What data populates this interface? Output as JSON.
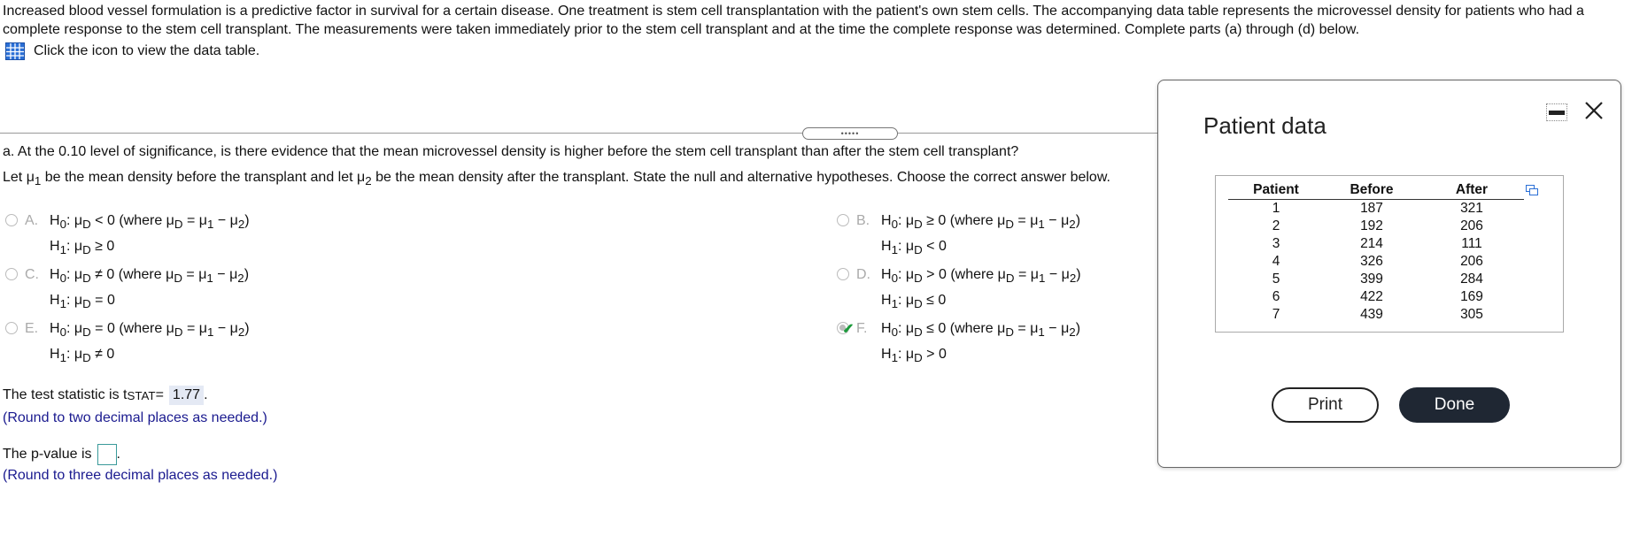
{
  "intro_text": "Increased blood vessel formulation is a predictive factor in survival for a certain disease. One treatment is stem cell transplantation with the patient's own stem cells. The accompanying data table represents the microvessel density for patients who had a complete response to the stem cell transplant. The measurements were taken immediately prior to the stem cell transplant and at the time the complete response was determined. Complete parts (a) through (d) below.",
  "data_link": {
    "icon": "table-icon",
    "label": "Click the icon to view the data table."
  },
  "grip": {
    "label": "•••••"
  },
  "question_a": "a. At the 0.10 level of significance, is there evidence that the mean microvessel density is higher before the stem cell transplant than after the stem cell transplant?",
  "question_let": {
    "p1": "Let μ",
    "s1": "1",
    "p2": " be the mean density before the transplant and let μ",
    "s2": "2",
    "p3": " be the mean density after the transplant. State the null and alternative hypotheses. Choose the correct answer below."
  },
  "options": [
    {
      "letter": "A.",
      "h0_op": "<",
      "h1_op": "≥",
      "selected": false
    },
    {
      "letter": "B.",
      "h0_op": "≥",
      "h1_op": "<",
      "selected": false
    },
    {
      "letter": "C.",
      "h0_op": "≠",
      "h1_op": "=",
      "selected": false
    },
    {
      "letter": "D.",
      "h0_op": ">",
      "h1_op": "≤",
      "selected": false
    },
    {
      "letter": "E.",
      "h0_op": "=",
      "h1_op": "≠",
      "selected": false
    },
    {
      "letter": "F.",
      "h0_op": "≤",
      "h1_op": ">",
      "selected": true
    }
  ],
  "hyp_parts": {
    "h": "H",
    "mu": "μ",
    "sub0": "0",
    "sub1": "1",
    "subD": "D",
    "zero": "0",
    "where": "(where μ",
    "eq": "= μ",
    "minus": "− μ",
    "sub2": "2",
    "close": ")"
  },
  "test_stat": {
    "label": "The test statistic is t",
    "sub": "STAT",
    "eq": " =",
    "value": "1.77",
    "end": ".",
    "hint": "(Round to two decimal places as needed.)"
  },
  "p_value": {
    "label": "The p-value is",
    "end": ".",
    "hint": "(Round to three decimal places as needed.)"
  },
  "panel": {
    "title": "Patient data",
    "headers": [
      "Patient",
      "Before",
      "After"
    ],
    "rows": [
      [
        "1",
        "187",
        "321"
      ],
      [
        "2",
        "192",
        "206"
      ],
      [
        "3",
        "214",
        "111"
      ],
      [
        "4",
        "326",
        "206"
      ],
      [
        "5",
        "399",
        "284"
      ],
      [
        "6",
        "422",
        "169"
      ],
      [
        "7",
        "439",
        "305"
      ]
    ],
    "print_label": "Print",
    "done_label": "Done"
  }
}
